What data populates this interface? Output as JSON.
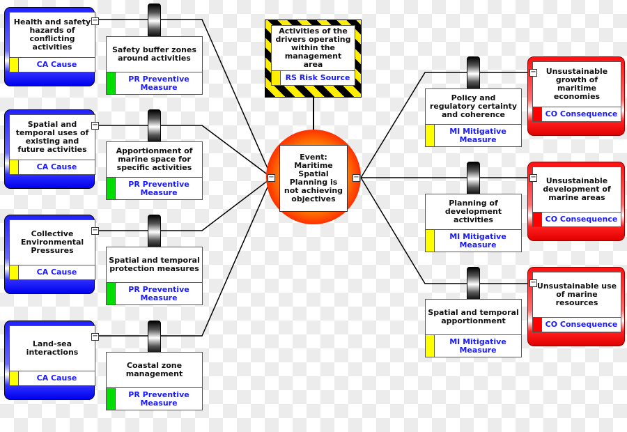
{
  "colors": {
    "cause": "#0000ff",
    "consequence": "#ff0000",
    "preventive_swatch": "#00dd00",
    "mitigative_swatch": "#ffff00",
    "cause_swatch": "#ffff00",
    "consequence_swatch": "#ff0000",
    "label_text": "#1a1aff"
  },
  "collapse_glyph": "−",
  "risk_source": {
    "text": "Activities of the drivers operating within the management area",
    "label": "RS Risk Source"
  },
  "event": {
    "text": "Event: Maritime Spatial Planning is not achieving objectives"
  },
  "causes": [
    {
      "text": "Health and safety hazards of conflicting activities",
      "label": "CA Cause"
    },
    {
      "text": "Spatial and temporal uses of existing and future activities",
      "label": "CA Cause"
    },
    {
      "text": "Collective Environmental Pressures",
      "label": "CA Cause"
    },
    {
      "text": "Land-sea interactions",
      "label": "CA Cause"
    }
  ],
  "preventive_barriers": [
    {
      "text": "Safety buffer zones around activities",
      "label": "PR Preventive Measure",
      "icon": "barrier-wheel-icon"
    },
    {
      "text": "Apportionment of marine space for specific activities",
      "label": "PR Preventive Measure",
      "icon": "barrier-wheel-icon"
    },
    {
      "text": "Spatial and temporal protection measures",
      "label": "PR Preventive Measure",
      "icon": "barrier-wheel-icon"
    },
    {
      "text": "Coastal zone management",
      "label": "PR Preventive Measure",
      "icon": "barrier-wheel-icon"
    }
  ],
  "mitigative_barriers": [
    {
      "text": "Policy and regulatory certainty and coherence",
      "label": "MI Mitigative Measure",
      "icon": "barrier-wheel-icon"
    },
    {
      "text": "Planning of development activities",
      "label": "MI Mitigative Measure",
      "icon": "barrier-wheel-icon"
    },
    {
      "text": "Spatial and temporal apportionment",
      "label": "MI Mitigative Measure",
      "icon": "barrier-wheel-icon"
    }
  ],
  "consequences": [
    {
      "text": "Unsustainable growth of maritime economies",
      "label": "CO Consequence"
    },
    {
      "text": "Unsustainable development of marine areas",
      "label": "CO Consequence"
    },
    {
      "text": "Unsustainable use of marine resources",
      "label": "CO Consequence"
    }
  ]
}
